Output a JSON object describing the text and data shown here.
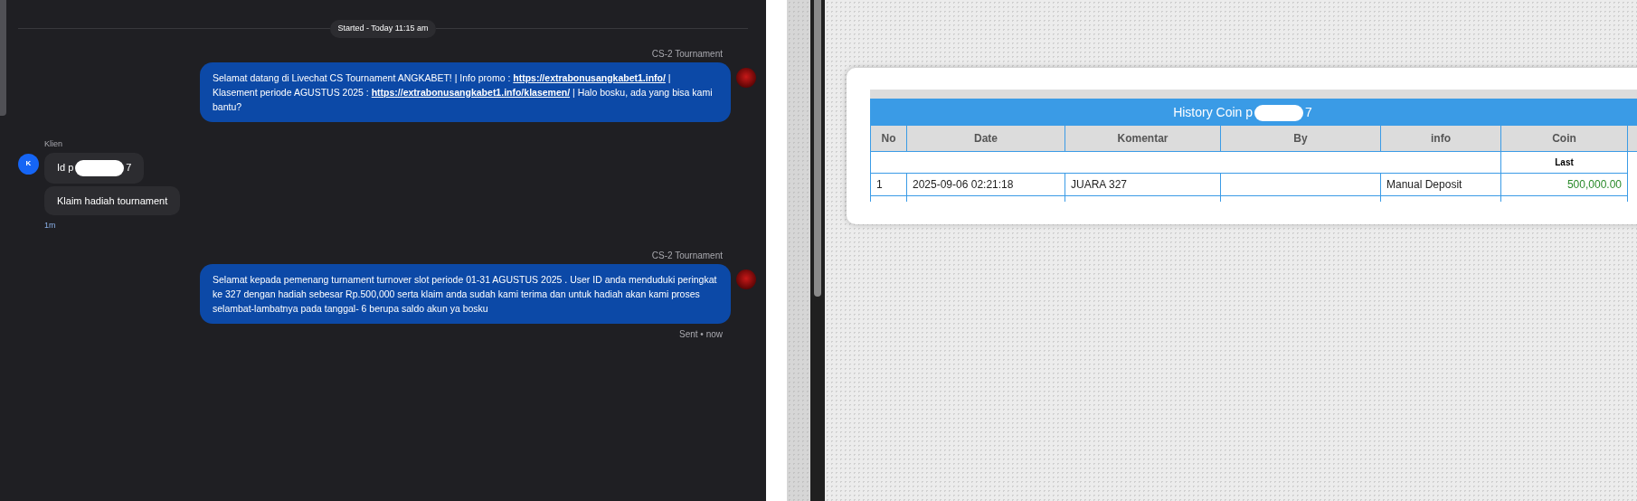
{
  "chat": {
    "session_label": "Started - Today 11:15 am",
    "groups": [
      {
        "kind": "agent",
        "sender": "CS-2 Tournament",
        "bubbles": [
          {
            "parts": [
              {
                "kind": "text",
                "text": "Selamat datang di Livechat CS Tournament ANGKABET! | Info promo : "
              },
              {
                "kind": "link",
                "text": "https://extrabonusangkabet1.info/"
              },
              {
                "kind": "text",
                "text": " | Klasement periode AGUSTUS 2025 : "
              },
              {
                "kind": "link",
                "text": "https://extrabonusangkabet1.info/klasemen/"
              },
              {
                "kind": "text",
                "text": " | Halo bosku, ada yang bisa kami bantu?"
              }
            ]
          }
        ]
      },
      {
        "kind": "client",
        "sender": "Klien",
        "avatar_letter": "K",
        "time": "1m",
        "bubbles": [
          {
            "parts": [
              {
                "kind": "text",
                "text": "Id p"
              },
              {
                "kind": "redacted"
              },
              {
                "kind": "text",
                "text": "7"
              }
            ]
          },
          {
            "parts": [
              {
                "kind": "text",
                "text": "Klaim hadiah tournament"
              }
            ]
          }
        ]
      },
      {
        "kind": "agent",
        "sender": "CS-2 Tournament",
        "status": "Sent • now",
        "bubbles": [
          {
            "parts": [
              {
                "kind": "text",
                "text": "Selamat kepada pemenang turnament turnover slot periode 01-31 AGUSTUS 2025 . User ID anda menduduki peringkat ke 327 dengan hadiah sebesar Rp.500,000 serta klaim anda sudah kami terima dan untuk hadiah akan kami proses selambat-lambatnya pada tanggal- 6 berupa saldo akun ya bosku"
              }
            ]
          }
        ]
      }
    ]
  },
  "history": {
    "title": [
      {
        "kind": "text",
        "text": "History Coin p"
      },
      {
        "kind": "redacted"
      },
      {
        "kind": "text",
        "text": "7"
      }
    ],
    "columns": [
      "No",
      "Date",
      "Komentar",
      "By",
      "info",
      "Coin"
    ],
    "subheader": {
      "coin": "Last"
    },
    "rows": [
      {
        "no": "1",
        "date": "2025-09-06 02:21:18",
        "komentar": "JUARA 327",
        "info": "Manual Deposit",
        "coin": "500,000.00"
      }
    ]
  }
}
